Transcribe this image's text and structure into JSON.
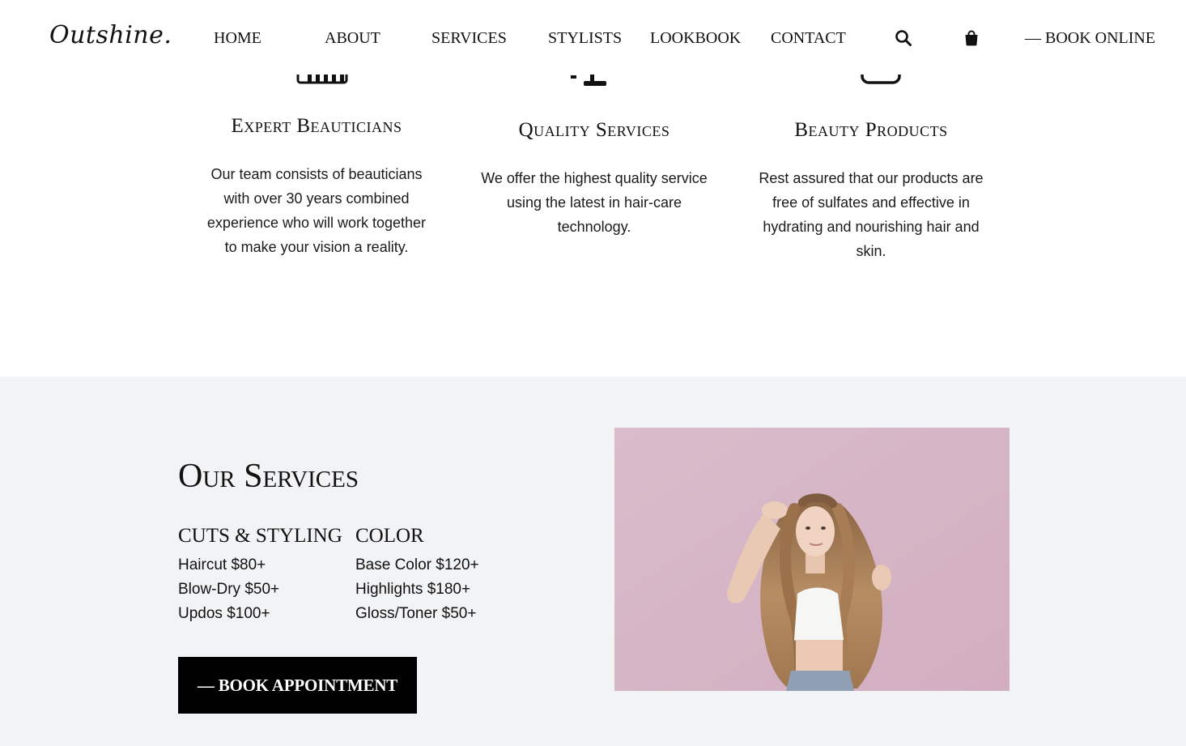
{
  "header": {
    "logo": "Outshine.",
    "nav": [
      "HOME",
      "ABOUT",
      "SERVICES",
      "STYLISTS",
      "LOOKBOOK",
      "CONTACT"
    ],
    "search_icon": "search-icon",
    "cart_icon": "shopping-bag-icon",
    "cta": "— BOOK ONLINE"
  },
  "features": [
    {
      "icon": "beautician-icon",
      "title": "Expert Beauticians",
      "text": "Our team consists of beauticians with over 30 years combined experience who will work together to make your vision a reality."
    },
    {
      "icon": "quality-icon",
      "title": "Quality Services",
      "text": "We offer the highest quality service using the latest in hair-care technology."
    },
    {
      "icon": "products-icon",
      "title": "Beauty Products",
      "text": "Rest assured that our products are free of sulfates and effective in hydrating and nourishing hair and skin."
    }
  ],
  "services": {
    "title": "Our Services",
    "categories": [
      {
        "heading": "CUTS & STYLING",
        "items": [
          "Haircut $80+",
          "Blow-Dry $50+",
          "Updos $100+"
        ]
      },
      {
        "heading": "COLOR",
        "items": [
          "Base Color $120+",
          "Highlights $180+",
          "Gloss/Toner $50+"
        ]
      }
    ],
    "button": "— BOOK APPOINTMENT",
    "photo_alt": "Woman with long curly hair on pink background"
  },
  "colors": {
    "text": "#111111",
    "section_bg": "#f2f3f5",
    "button_bg": "#000000",
    "button_text": "#ffffff",
    "photo_bg": "#d8b9c8"
  }
}
